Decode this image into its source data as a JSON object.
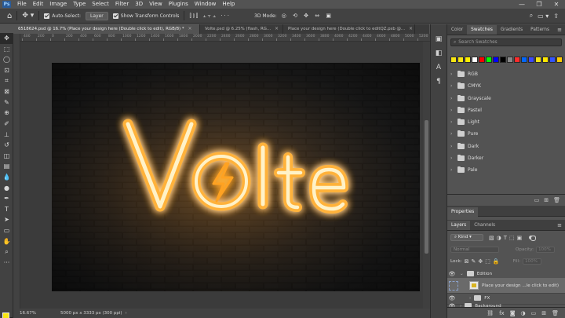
{
  "app": {
    "logo_text": "Ps",
    "menu": [
      "File",
      "Edit",
      "Image",
      "Type",
      "Select",
      "Filter",
      "3D",
      "View",
      "Plugins",
      "Window",
      "Help"
    ],
    "window_controls": [
      "—",
      "❐",
      "✕"
    ]
  },
  "options_bar": {
    "auto_select_label": "Auto-Select:",
    "auto_select_target": "Layer",
    "transform_controls_label": "Show Transform Controls",
    "mode_3d_label": "3D Mode:"
  },
  "tabs": [
    {
      "label": "6518624.psd @ 16.7% (Place your design here (Double click to edit), RGB/8) *",
      "active": true
    },
    {
      "label": "Volte.psd @ 6.25% (flash, RG...",
      "active": false
    },
    {
      "label": "Place your design here (Double click to editQZ.psb @...",
      "active": false
    }
  ],
  "ruler_top_labels": [
    "400",
    "200",
    "0",
    "200",
    "400",
    "600",
    "800",
    "1000",
    "1200",
    "1400",
    "1600",
    "1800",
    "2000",
    "2200",
    "2400",
    "2600",
    "2800",
    "3000",
    "3200",
    "3400",
    "3600",
    "3800",
    "4000",
    "4200",
    "4400",
    "4600",
    "4800",
    "5000",
    "5200",
    "54"
  ],
  "canvas": {
    "artwork_text": "Vlte",
    "artwork_word_letters": [
      "V",
      "l",
      "t",
      "e"
    ],
    "glow_color": "#ffb13b",
    "core_color": "#fff3c9"
  },
  "status": {
    "zoom": "16.67%",
    "doc_info": "5000 px x 3333 px (300 ppi)"
  },
  "swatches_panel": {
    "tabs": [
      "Color",
      "Swatches",
      "Gradients",
      "Patterns"
    ],
    "active_tab": "Swatches",
    "search_placeholder": "Search Swatches",
    "recent_colors": [
      "#f8e612",
      "#f8e612",
      "#fff000",
      "#ffffff",
      "#ff0000",
      "#00ff00",
      "#0000ff",
      "#000000",
      "#888888",
      "#ff2b2b",
      "#0066ff",
      "#3c4aff",
      "#f8e612",
      "#ffe600",
      "#3355ff",
      "#ffcc00"
    ],
    "groups": [
      "RGB",
      "CMYK",
      "Grayscale",
      "Pastel",
      "Light",
      "Pure",
      "Dark",
      "Darker",
      "Pale"
    ]
  },
  "properties_panel": {
    "tab": "Properties"
  },
  "layers_panel": {
    "tabs": [
      "Layers",
      "Channels"
    ],
    "active_tab": "Layers",
    "kind_label": "Kind",
    "blend_mode": "Normal",
    "opacity_label": "Opacity:",
    "opacity_value": "100%",
    "lock_label": "Lock:",
    "fill_label": "Fill:",
    "fill_value": "100%",
    "layers": [
      {
        "name": "Edition",
        "type": "group",
        "visible": true,
        "expanded": true,
        "selected": false
      },
      {
        "name": "Place your design ...le click to edit)",
        "type": "smart-object",
        "visible": false,
        "selected": true
      },
      {
        "name": "FX",
        "type": "group",
        "visible": true,
        "expanded": false,
        "selected": false
      },
      {
        "name": "Background",
        "type": "group",
        "visible": true,
        "expanded": false,
        "selected": false
      }
    ]
  }
}
